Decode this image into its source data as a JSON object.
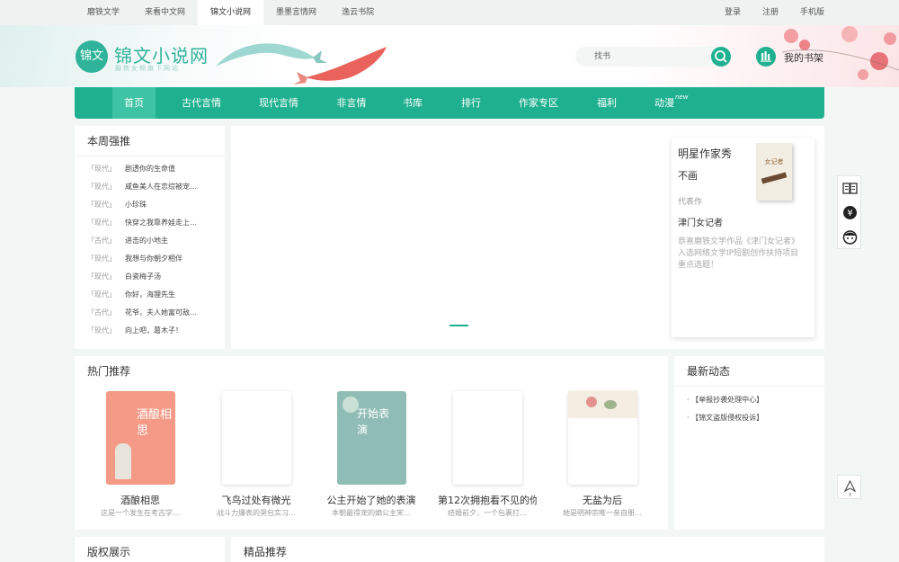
{
  "topbar": {
    "sites": [
      "磨铁文学",
      "来看中文网",
      "锦文小说网",
      "墨墨言情网",
      "逸云书院"
    ],
    "active_site": 2,
    "links": [
      "登录",
      "注册",
      "手机版"
    ]
  },
  "header": {
    "logo_badge": "锦文",
    "logo_text": "锦文小说网",
    "slogan": "磨铁女频旗下网站",
    "search_placeholder": "找书",
    "shelf_label": "我的书架"
  },
  "nav": {
    "items": [
      "首页",
      "古代言情",
      "现代言情",
      "非言情",
      "书库",
      "排行",
      "作家专区",
      "福利",
      "动漫"
    ],
    "active": 0,
    "new_badge": "new"
  },
  "weekly": {
    "title": "本周强推",
    "items": [
      {
        "tag": "「现代」",
        "title": "剧透你的生命值"
      },
      {
        "tag": "「现代」",
        "title": "咸鱼美人在恋综被宠…"
      },
      {
        "tag": "「现代」",
        "title": "小珍珠"
      },
      {
        "tag": "「现代」",
        "title": "快穿之我靠养娃走上…"
      },
      {
        "tag": "「古代」",
        "title": "进击的小地主"
      },
      {
        "tag": "「现代」",
        "title": "我想与你朝夕相伴"
      },
      {
        "tag": "「现代」",
        "title": "白瓷梅子汤"
      },
      {
        "tag": "「现代」",
        "title": "你好，海狸先生"
      },
      {
        "tag": "「古代」",
        "title": "花爷，夫人她富可敌…"
      },
      {
        "tag": "「现代」",
        "title": "向上吧，葛木子！"
      }
    ]
  },
  "author": {
    "heading": "明星作家秀",
    "name": "不画",
    "rep_label": "代表作",
    "rep_work": "津门女记者",
    "desc": "恭喜磨铁文学作品《津门女记者》入选网络文学IP短剧创作扶持项目重点选题！",
    "cover_text": "女记者"
  },
  "hot": {
    "title": "热门推荐",
    "books": [
      {
        "title": "酒酿相思",
        "desc": "这是一个发生在考古学…",
        "cover_text": "酒酿相思",
        "cover_color": "#f49a86"
      },
      {
        "title": "飞鸟过处有微光",
        "desc": "战斗力爆表的哭包实习…",
        "cover_text": "",
        "cover_color": "#ffffff"
      },
      {
        "title": "公主开始了她的表演",
        "desc": "本朝最得宠的嫡公主宋…",
        "cover_text": "开始表演",
        "cover_color": "#8fbdb5"
      },
      {
        "title": "第12次拥抱看不见的你",
        "desc": "结婚前夕，一个包裹打…",
        "cover_text": "",
        "cover_color": "#ffffff"
      },
      {
        "title": "无盐为后",
        "desc": "她是明神宗唯一亲自册…",
        "cover_text": "",
        "cover_color": "#f4ede2"
      }
    ]
  },
  "news": {
    "title": "最新动态",
    "items": [
      "【举报抄袭处理中心】",
      "【锦文盗版侵权投诉】"
    ]
  },
  "copyright": {
    "title": "版权展示"
  },
  "premium": {
    "title": "精品推荐"
  },
  "colors": {
    "brand": "#1fb08f",
    "brand_light": "#3ec3a4",
    "background": "#f2f6f5"
  }
}
